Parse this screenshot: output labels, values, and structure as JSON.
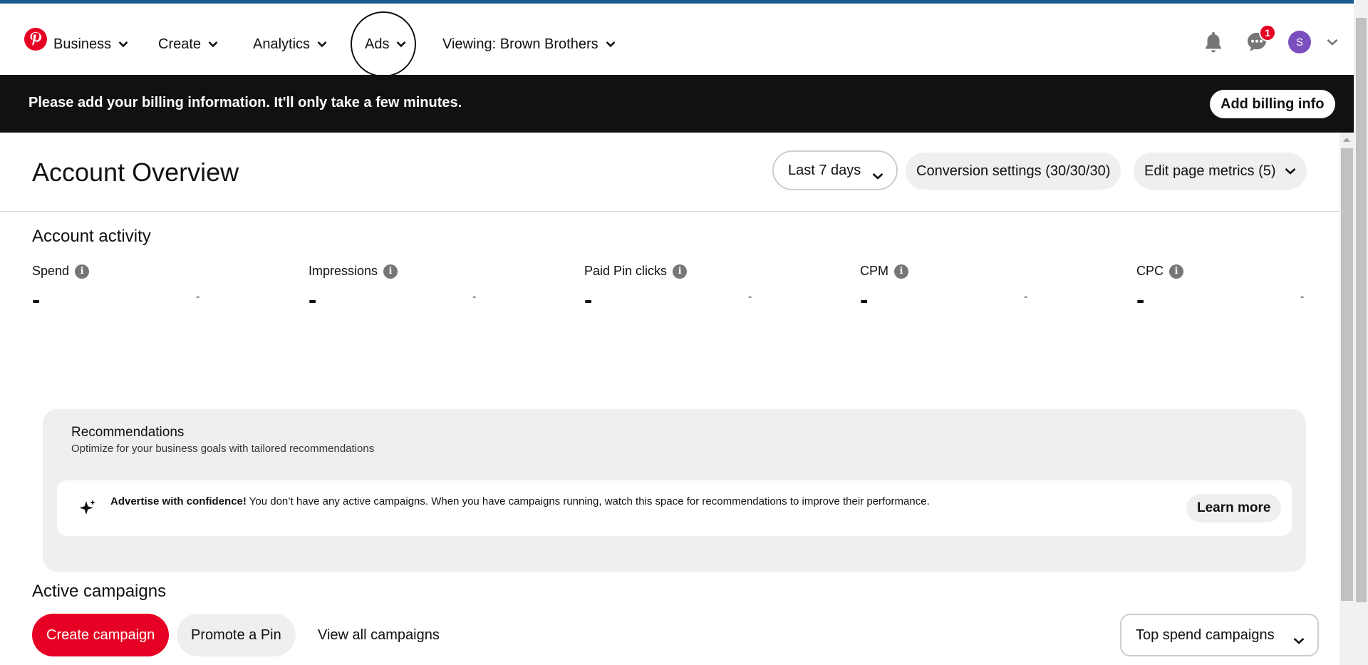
{
  "colors": {
    "brand": "#e60023",
    "banner_bg": "#111111",
    "accent_bar": "#1a5b8c",
    "avatar_bg": "#7b4fbf"
  },
  "header": {
    "logo_icon": "pinterest-logo-icon",
    "nav": [
      {
        "label": "Business"
      },
      {
        "label": "Create"
      },
      {
        "label": "Analytics"
      },
      {
        "label": "Ads"
      },
      {
        "label": "Viewing: Brown Brothers"
      }
    ],
    "notification_count": "1",
    "avatar_letter": "S"
  },
  "banner": {
    "message": "Please add your billing information. It'll only take a few minutes.",
    "button_label": "Add billing info"
  },
  "overview": {
    "title": "Account Overview",
    "date_range": "Last 7 days",
    "conversion_settings": "Conversion settings (30/30/30)",
    "edit_metrics": "Edit page metrics (5)"
  },
  "activity": {
    "title": "Account activity",
    "metrics": [
      {
        "label": "Spend",
        "value": "-",
        "delta": "-"
      },
      {
        "label": "Impressions",
        "value": "-",
        "delta": "-"
      },
      {
        "label": "Paid Pin clicks",
        "value": "-",
        "delta": "-"
      },
      {
        "label": "CPM",
        "value": "-",
        "delta": "-"
      },
      {
        "label": "CPC",
        "value": "-",
        "delta": "-"
      }
    ]
  },
  "recommendations": {
    "title": "Recommendations",
    "subtitle": "Optimize for your business goals with tailored recommendations",
    "card_bold": "Advertise with confidence!",
    "card_text": " You don’t have any active campaigns. When you have campaigns running, watch this space for recommendations to improve their performance.",
    "card_button": "Learn more"
  },
  "campaigns": {
    "title": "Active campaigns",
    "create_button": "Create campaign",
    "promote_button": "Promote a Pin",
    "view_all": "View all campaigns",
    "filter": "Top spend campaigns"
  }
}
